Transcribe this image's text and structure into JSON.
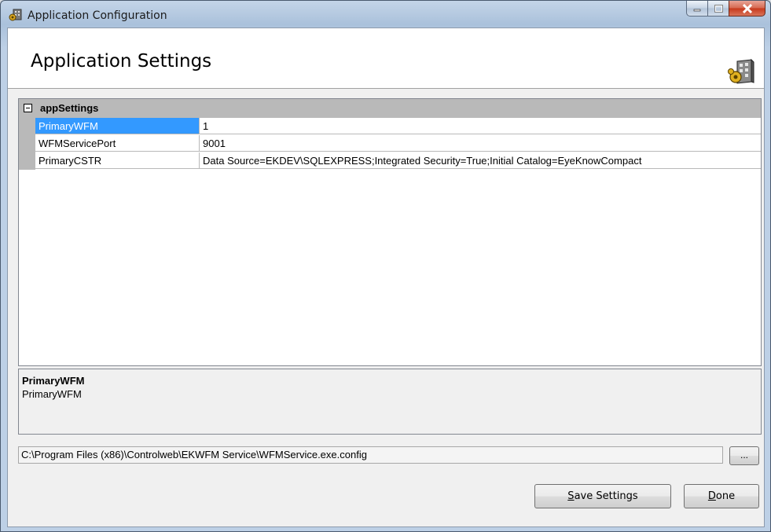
{
  "window": {
    "title": "Application Configuration"
  },
  "header": {
    "title": "Application Settings"
  },
  "grid": {
    "category": "appSettings",
    "rows": [
      {
        "name": "PrimaryWFM",
        "value": "1",
        "selected": true
      },
      {
        "name": "WFMServicePort",
        "value": "9001",
        "selected": false
      },
      {
        "name": "PrimaryCSTR",
        "value": "Data Source=EKDEV\\SQLEXPRESS;Integrated Security=True;Initial Catalog=EyeKnowCompact",
        "selected": false
      }
    ]
  },
  "help": {
    "title": "PrimaryWFM",
    "description": "PrimaryWFM"
  },
  "config_path": "C:\\Program Files (x86)\\Controlweb\\EKWFM Service\\WFMService.exe.config",
  "buttons": {
    "browse": "...",
    "save_mnemonic": "S",
    "save_rest": "ave Settings",
    "done_mnemonic": "D",
    "done_rest": "one"
  },
  "colors": {
    "selection": "#3399ff",
    "category_bg": "#b9b9b9"
  }
}
